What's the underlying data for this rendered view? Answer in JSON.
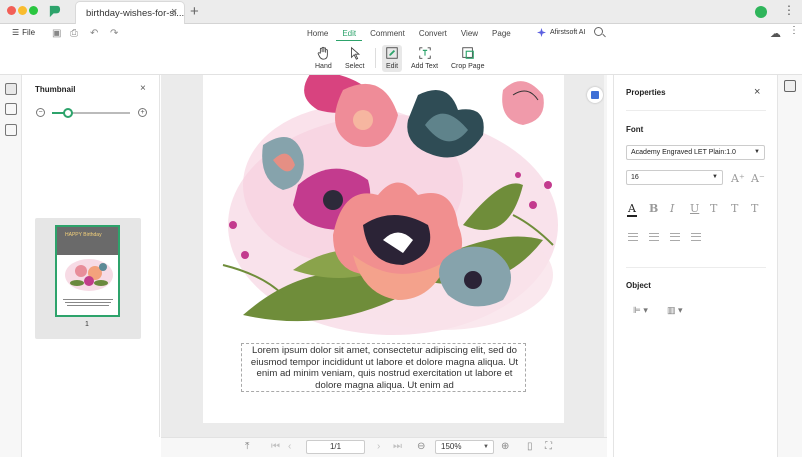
{
  "window": {
    "tab_title": "birthday-wishes-for-si...",
    "tab_close": "×",
    "new_tab": "+"
  },
  "toolbar": {
    "file_label": "File",
    "nav_tabs": [
      {
        "label": "Home",
        "active": false
      },
      {
        "label": "Edit",
        "active": true
      },
      {
        "label": "Comment",
        "active": false
      },
      {
        "label": "Convert",
        "active": false
      },
      {
        "label": "View",
        "active": false
      },
      {
        "label": "Page",
        "active": false
      }
    ],
    "ai_label": "Afirstsoft AI",
    "tools": [
      {
        "label": "Hand",
        "icon": "hand-icon"
      },
      {
        "label": "Select",
        "icon": "cursor-icon"
      },
      {
        "label": "Edit",
        "icon": "edit-icon",
        "active": true
      },
      {
        "label": "Add Text",
        "icon": "add-text-icon"
      },
      {
        "label": "Crop Page",
        "icon": "crop-icon"
      }
    ]
  },
  "thumbnail_panel": {
    "title": "Thumbnail",
    "close": "×",
    "zoom_level": 0.2,
    "thumb_text": "HAPPY Birthday",
    "page_number": "1"
  },
  "document": {
    "body_text": "Lorem ipsum dolor sit amet, consectetur adipiscing elit, sed do eiusmod tempor incididunt ut labore et dolore magna aliqua. Ut enim ad minim veniam, quis nostrud exercitation ut labore et dolore magna aliqua. Ut enim ad"
  },
  "statusbar": {
    "page_value": "1/1",
    "zoom_value": "150%"
  },
  "properties": {
    "title": "Properties",
    "close": "×",
    "font_section": "Font",
    "font_family": "Academy Engraved LET Plain:1.0",
    "font_size": "16",
    "object_section": "Object"
  },
  "colors": {
    "accent": "#2da36b",
    "traffic_red": "#f25f57",
    "traffic_yellow": "#f9bc2e",
    "traffic_green": "#2ac640"
  }
}
